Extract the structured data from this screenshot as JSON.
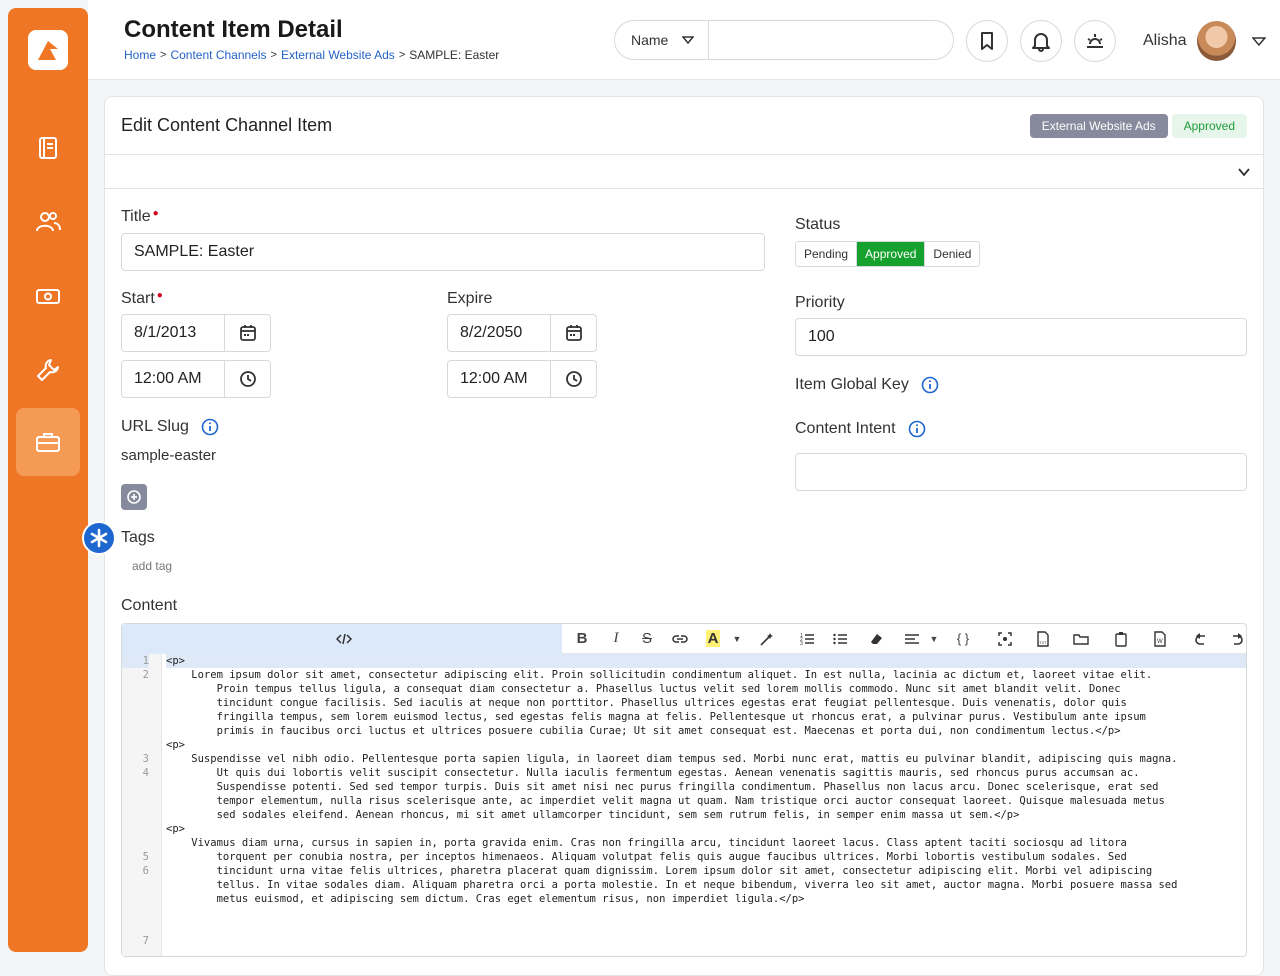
{
  "header": {
    "title": "Content Item Detail",
    "breadcrumb": [
      "Home",
      "Content Channels",
      "External Website Ads",
      "SAMPLE: Easter"
    ],
    "search_type": "Name",
    "search_value": "",
    "user_name": "Alisha"
  },
  "sidebar": {
    "items": [
      {
        "icon": "book-icon"
      },
      {
        "icon": "people-icon"
      },
      {
        "icon": "money-icon"
      },
      {
        "icon": "wrench-icon"
      },
      {
        "icon": "briefcase-icon"
      }
    ]
  },
  "card": {
    "title": "Edit Content Channel Item",
    "channel_badge": "External Website Ads",
    "status_badge": "Approved"
  },
  "form": {
    "title_label": "Title",
    "title_value": "SAMPLE: Easter",
    "start_label": "Start",
    "start_date": "8/1/2013",
    "start_time": "12:00 AM",
    "expire_label": "Expire",
    "expire_date": "8/2/2050",
    "expire_time": "12:00 AM",
    "url_slug_label": "URL Slug",
    "url_slug_value": "sample-easter",
    "tags_label": "Tags",
    "add_tag": "add tag",
    "content_label": "Content",
    "status_label": "Status",
    "status_options": [
      "Pending",
      "Approved",
      "Denied"
    ],
    "status_selected": "Approved",
    "priority_label": "Priority",
    "priority_value": "100",
    "global_key_label": "Item Global Key",
    "content_intent_label": "Content Intent",
    "content_intent_value": ""
  },
  "editor": {
    "line_numbers": [
      "1",
      "2",
      "",
      "",
      "",
      "",
      "",
      "3",
      "4",
      "",
      "",
      "",
      "",
      "",
      "5",
      "6",
      "",
      "",
      "",
      "",
      "7"
    ],
    "lines": [
      "<p>",
      "    Lorem ipsum dolor sit amet, consectetur adipiscing elit. Proin sollicitudin condimentum aliquet. In est nulla, lacinia ac dictum et, laoreet vitae elit.",
      "        Proin tempus tellus ligula, a consequat diam consectetur a. Phasellus luctus velit sed lorem mollis commodo. Nunc sit amet blandit velit. Donec",
      "        tincidunt congue facilisis. Sed iaculis at neque non porttitor. Phasellus ultrices egestas erat feugiat pellentesque. Duis venenatis, dolor quis",
      "        fringilla tempus, sem lorem euismod lectus, sed egestas felis magna at felis. Pellentesque ut rhoncus erat, a pulvinar purus. Vestibulum ante ipsum",
      "        primis in faucibus orci luctus et ultrices posuere cubilia Curae; Ut sit amet consequat est. Maecenas et porta dui, non condimentum lectus.</p>",
      "<p>",
      "    Suspendisse vel nibh odio. Pellentesque porta sapien ligula, in laoreet diam tempus sed. Morbi nunc erat, mattis eu pulvinar blandit, adipiscing quis magna.",
      "        Ut quis dui lobortis velit suscipit consectetur. Nulla iaculis fermentum egestas. Aenean venenatis sagittis mauris, sed rhoncus purus accumsan ac.",
      "        Suspendisse potenti. Sed sed tempor turpis. Duis sit amet nisi nec purus fringilla condimentum. Phasellus non lacus arcu. Donec scelerisque, erat sed",
      "        tempor elementum, nulla risus scelerisque ante, ac imperdiet velit magna ut quam. Nam tristique orci auctor consequat laoreet. Quisque malesuada metus",
      "        sed sodales eleifend. Aenean rhoncus, mi sit amet ullamcorper tincidunt, sem sem rutrum felis, in semper enim massa ut sem.</p>",
      "<p>",
      "    Vivamus diam urna, cursus in sapien in, porta gravida enim. Cras non fringilla arcu, tincidunt laoreet lacus. Class aptent taciti sociosqu ad litora",
      "        torquent per conubia nostra, per inceptos himenaeos. Aliquam volutpat felis quis augue faucibus ultrices. Morbi lobortis vestibulum sodales. Sed",
      "        tincidunt urna vitae felis ultrices, pharetra placerat quam dignissim. Lorem ipsum dolor sit amet, consectetur adipiscing elit. Morbi vel adipiscing",
      "        tellus. In vitae sodales diam. Aliquam pharetra orci a porta molestie. In et neque bibendum, viverra leo sit amet, auctor magna. Morbi posuere massa sed",
      "        metus euismod, et adipiscing sem dictum. Cras eget elementum risus, non imperdiet ligula.</p>",
      "",
      "",
      ""
    ]
  },
  "colors": {
    "brand": "#ee7624",
    "approved": "#16a02d",
    "link": "#2563c7"
  }
}
